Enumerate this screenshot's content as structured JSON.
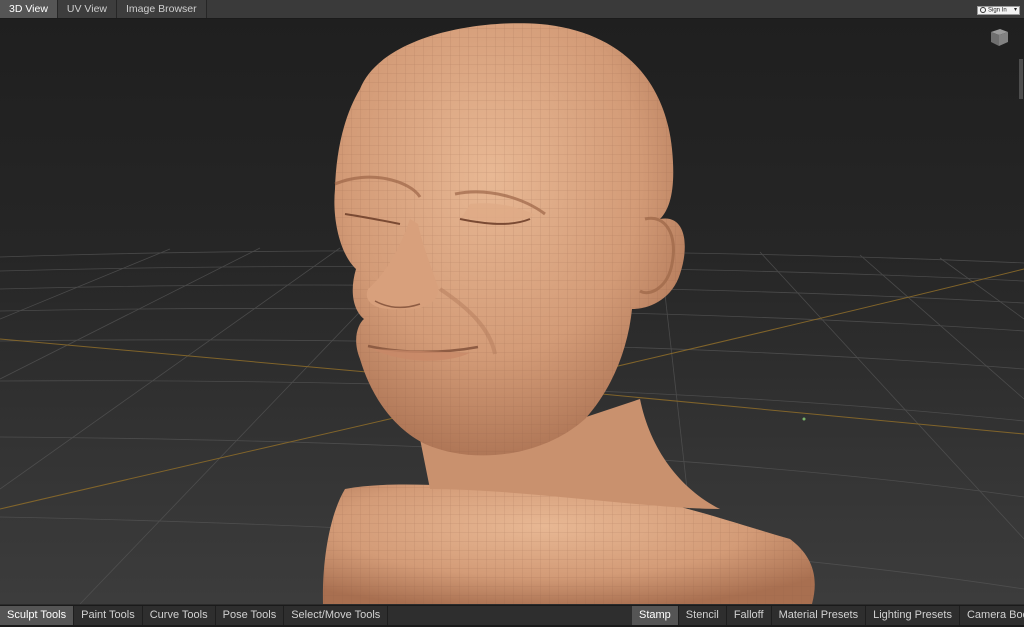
{
  "top_tabs": [
    {
      "label": "3D View",
      "active": true
    },
    {
      "label": "UV View",
      "active": false
    },
    {
      "label": "Image Browser",
      "active": false
    }
  ],
  "signin": {
    "label": "Sign In"
  },
  "viewport": {
    "grid_color": "#4a4a4a",
    "axis_color": "#8a6a2a",
    "model_skin_color": "#d9a27e",
    "background_color": "#262626"
  },
  "viewcube": {
    "icon": "view-cube-icon"
  },
  "bottom_left_tabs": [
    {
      "label": "Sculpt Tools",
      "active": true
    },
    {
      "label": "Paint Tools",
      "active": false
    },
    {
      "label": "Curve Tools",
      "active": false
    },
    {
      "label": "Pose Tools",
      "active": false
    },
    {
      "label": "Select/Move Tools",
      "active": false
    }
  ],
  "bottom_right_tabs": [
    {
      "label": "Stamp",
      "active": true
    },
    {
      "label": "Stencil",
      "active": false
    },
    {
      "label": "Falloff",
      "active": false
    },
    {
      "label": "Material Presets",
      "active": false
    },
    {
      "label": "Lighting Presets",
      "active": false
    },
    {
      "label": "Camera Boo",
      "active": false
    }
  ]
}
